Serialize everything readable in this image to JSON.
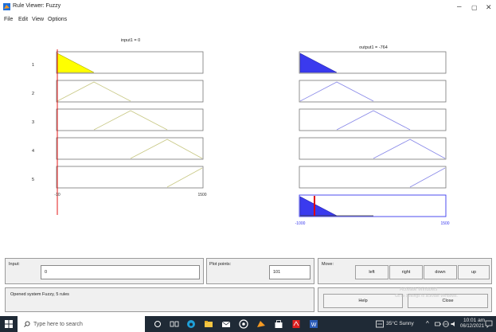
{
  "window": {
    "title": "Rule Viewer: Fuzzy",
    "controls": {
      "minimize": "–",
      "maximize": "▢",
      "close": "✕"
    }
  },
  "menu": {
    "items": [
      "File",
      "Edit",
      "View",
      "Options"
    ]
  },
  "viewer": {
    "input_header": "input1 = 0",
    "output_header": "output1 = -764",
    "rule_numbers": [
      "1",
      "2",
      "3",
      "4",
      "5"
    ],
    "input_axis": {
      "min_label": "-10",
      "max_label": "1500"
    },
    "output_axis": {
      "min_label": "-1000",
      "max_label": "1500"
    },
    "colors": {
      "input_fill": "#ffff00",
      "output_fill": "#3a3aee",
      "input_line": "#c8c884",
      "output_line": "#8888e8",
      "marker": "#e00000"
    }
  },
  "controls": {
    "input_label": "Input:",
    "input_value": "0",
    "plot_points_label": "Plot points:",
    "plot_points_value": "101",
    "move_label": "Move:",
    "move_buttons": [
      "left",
      "right",
      "down",
      "up"
    ],
    "status_text": "Opened system Fuzzy, 5 rules",
    "help_label": "Help",
    "close_label": "Close",
    "watermark_line1": "Activate Windows",
    "watermark_line2": "Go to Settings to activate Windows."
  },
  "taskbar": {
    "search_placeholder": "Type here to search",
    "weather": "35°C  Sunny",
    "time": "10:01 am",
    "date": "06/12/2021"
  }
}
